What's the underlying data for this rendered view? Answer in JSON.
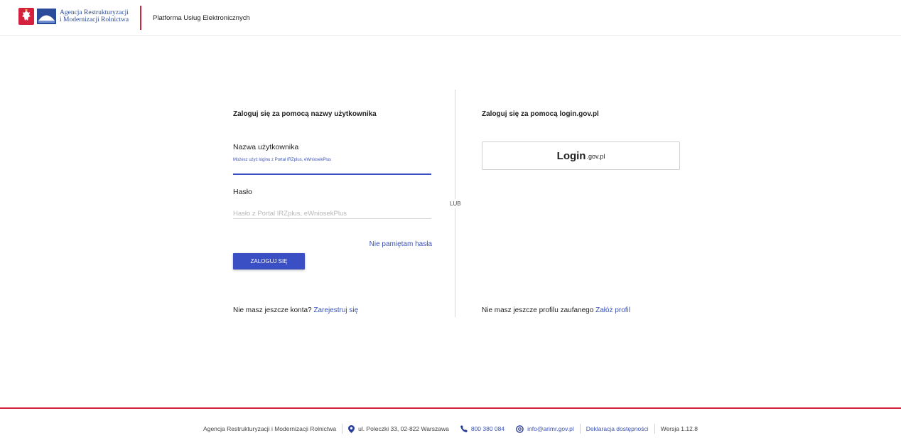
{
  "header": {
    "agency_line1": "Agencja Restrukturyzacji",
    "agency_line2": "i Modernizacji Rolnictwa",
    "platform_title": "Platforma Usług Elektronicznych"
  },
  "left": {
    "title": "Zaloguj się za pomocą nazwy użytkownika",
    "username_label": "Nazwa użytkownika",
    "username_hint": "Możesz użyć loginu z Portal IRZplus, eWniosekPlus",
    "password_label": "Hasło",
    "password_placeholder": "Hasło z Portal IRZplus, eWniosekPlus",
    "forgot_link": "Nie pamiętam hasła",
    "login_button": "ZALOGUJ SIĘ",
    "no_account_text": "Nie masz jeszcze konta?",
    "register_link": "Zarejestruj się"
  },
  "divider": {
    "label": "LUB"
  },
  "right": {
    "title": "Zaloguj się za pomocą login.gov.pl",
    "logingov_big": "Login",
    "logingov_small": ".gov.pl",
    "no_profile_text": "Nie masz jeszcze profilu zaufanego",
    "create_profile_link": "Załóż profil"
  },
  "footer": {
    "agency": "Agencja Restrukturyzacji i Modernizacji Rolnictwa",
    "address": "ul. Poleczki 33, 02-822 Warszawa",
    "phone": "800 380 084",
    "email": "info@arimr.gov.pl",
    "accessibility": "Deklaracja dostępności",
    "version": "Wersja 1.12.8"
  },
  "colors": {
    "brand_red": "#d4213d",
    "primary_blue": "#3a4fc4",
    "link_blue": "#3a52b8"
  },
  "icons": [
    "poland-emblem-icon",
    "arimr-logo-icon",
    "location-pin-icon",
    "phone-icon",
    "at-sign-icon"
  ]
}
